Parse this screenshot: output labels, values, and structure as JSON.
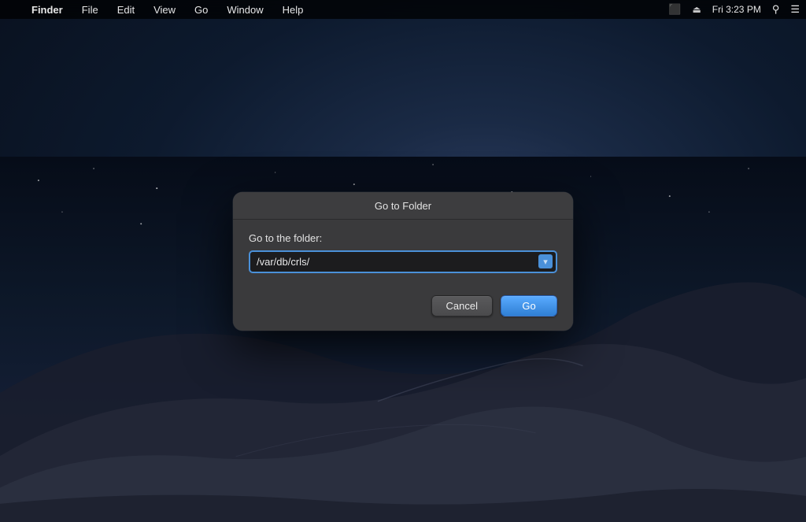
{
  "menubar": {
    "apple": "",
    "items": [
      {
        "label": "Finder",
        "active": true
      },
      {
        "label": "File"
      },
      {
        "label": "Edit"
      },
      {
        "label": "View"
      },
      {
        "label": "Go"
      },
      {
        "label": "Window"
      },
      {
        "label": "Help"
      }
    ],
    "right": {
      "icons": [
        "screen-icon",
        "eject-icon"
      ],
      "time": "Fri 3:23 PM",
      "search_icon": "search",
      "menu_icon": "menu"
    }
  },
  "dialog": {
    "title": "Go to Folder",
    "label": "Go to the folder:",
    "input_value": "/var/db/crls/",
    "input_placeholder": "/var/db/crls/",
    "dropdown_arrow": "▾",
    "buttons": {
      "cancel": "Cancel",
      "go": "Go"
    }
  },
  "desktop": {
    "background_description": "macOS Mojave dark desert dune night wallpaper"
  }
}
